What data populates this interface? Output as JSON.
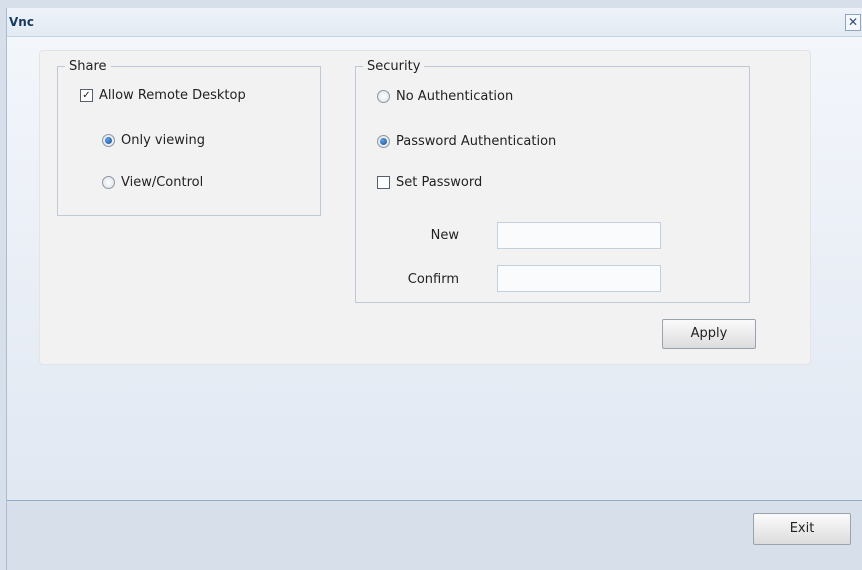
{
  "window": {
    "title": "Vnc",
    "close_glyph": "✕"
  },
  "share": {
    "legend": "Share",
    "allow_remote": {
      "label": "Allow Remote Desktop",
      "checked": true
    },
    "options": [
      {
        "label": "Only viewing",
        "selected": true
      },
      {
        "label": "View/Control",
        "selected": false
      }
    ]
  },
  "security": {
    "legend": "Security",
    "options": [
      {
        "label": "No Authentication",
        "selected": false
      },
      {
        "label": "Password Authentication",
        "selected": true
      }
    ],
    "set_password": {
      "label": "Set Password",
      "checked": false
    },
    "new_label": "New",
    "new_value": "",
    "confirm_label": "Confirm",
    "confirm_value": ""
  },
  "buttons": {
    "apply": "Apply",
    "exit": "Exit"
  },
  "icons": {
    "close": "close-icon",
    "check": "check-icon"
  }
}
